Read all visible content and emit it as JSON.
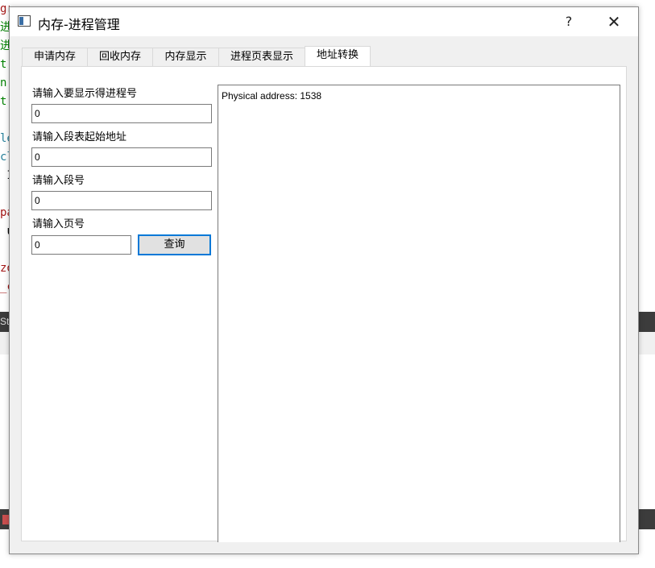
{
  "background": {
    "code_lines": [
      {
        "text": "gr",
        "color": "#a31515"
      },
      {
        "text": "进",
        "color": "#008000"
      },
      {
        "text": "进",
        "color": "#008000"
      },
      {
        "text": "t'",
        "color": "#008000"
      },
      {
        "text": "n'",
        "color": "#008000"
      },
      {
        "text": "t'",
        "color": "#008000"
      },
      {
        "text": "",
        "color": "#000000"
      },
      {
        "text": "le",
        "color": "#267f99"
      },
      {
        "text": "cl",
        "color": "#267f99"
      },
      {
        "text": " I",
        "color": "#000000"
      },
      {
        "text": "",
        "color": "#000000"
      },
      {
        "text": "pa",
        "color": "#a31515"
      },
      {
        "text": " u",
        "color": "#000000"
      },
      {
        "text": "  ",
        "color": "#000000"
      },
      {
        "text": "zo",
        "color": "#a31515"
      },
      {
        "text": "_c",
        "color": "#a31515"
      }
    ],
    "status_fragment": "St"
  },
  "window": {
    "title": "内存-进程管理",
    "help_label": "?",
    "close_label": "✕"
  },
  "tabs": [
    {
      "label": "申请内存"
    },
    {
      "label": "回收内存"
    },
    {
      "label": "内存显示"
    },
    {
      "label": "进程页表显示"
    },
    {
      "label": "地址转换"
    }
  ],
  "active_tab": "地址转换",
  "form": {
    "process_label": "请输入要显示得进程号",
    "process_value": "0",
    "segment_start_label": "请输入段表起始地址",
    "segment_start_value": "0",
    "segment_label": "请输入段号",
    "segment_value": "0",
    "page_label": "请输入页号",
    "page_value": "0",
    "query_button": "查询"
  },
  "output": {
    "text": "Physical address: 1538"
  }
}
